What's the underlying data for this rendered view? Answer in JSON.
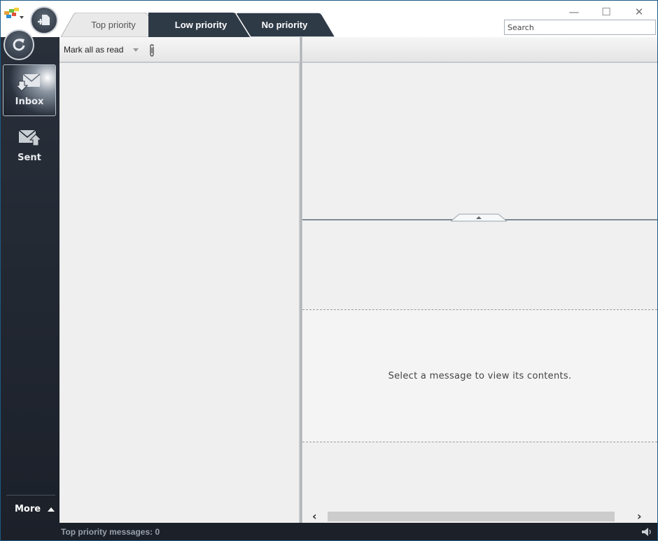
{
  "window": {
    "controls": {
      "minimize": "—",
      "maximize": "☐",
      "close": "✕"
    }
  },
  "search": {
    "placeholder": "Search",
    "value": ""
  },
  "tabs": [
    {
      "label": "Top priority",
      "active": true
    },
    {
      "label": "Low priority",
      "active": false
    },
    {
      "label": "No priority",
      "active": false
    }
  ],
  "sidebar": {
    "items": [
      {
        "label": "Inbox",
        "icon": "inbox-icon",
        "active": true
      },
      {
        "label": "Sent",
        "icon": "sent-icon",
        "active": false
      }
    ],
    "more_label": "More"
  },
  "list_toolbar": {
    "mark_all_read": "Mark all as read"
  },
  "reading_pane": {
    "empty_message": "Select a message to view its contents."
  },
  "statusbar": {
    "text": "Top priority messages: 0"
  },
  "colors": {
    "sidebar_bg": "#1b2029",
    "tab_dark": "#2d3845",
    "window_border": "#1e5a86"
  }
}
